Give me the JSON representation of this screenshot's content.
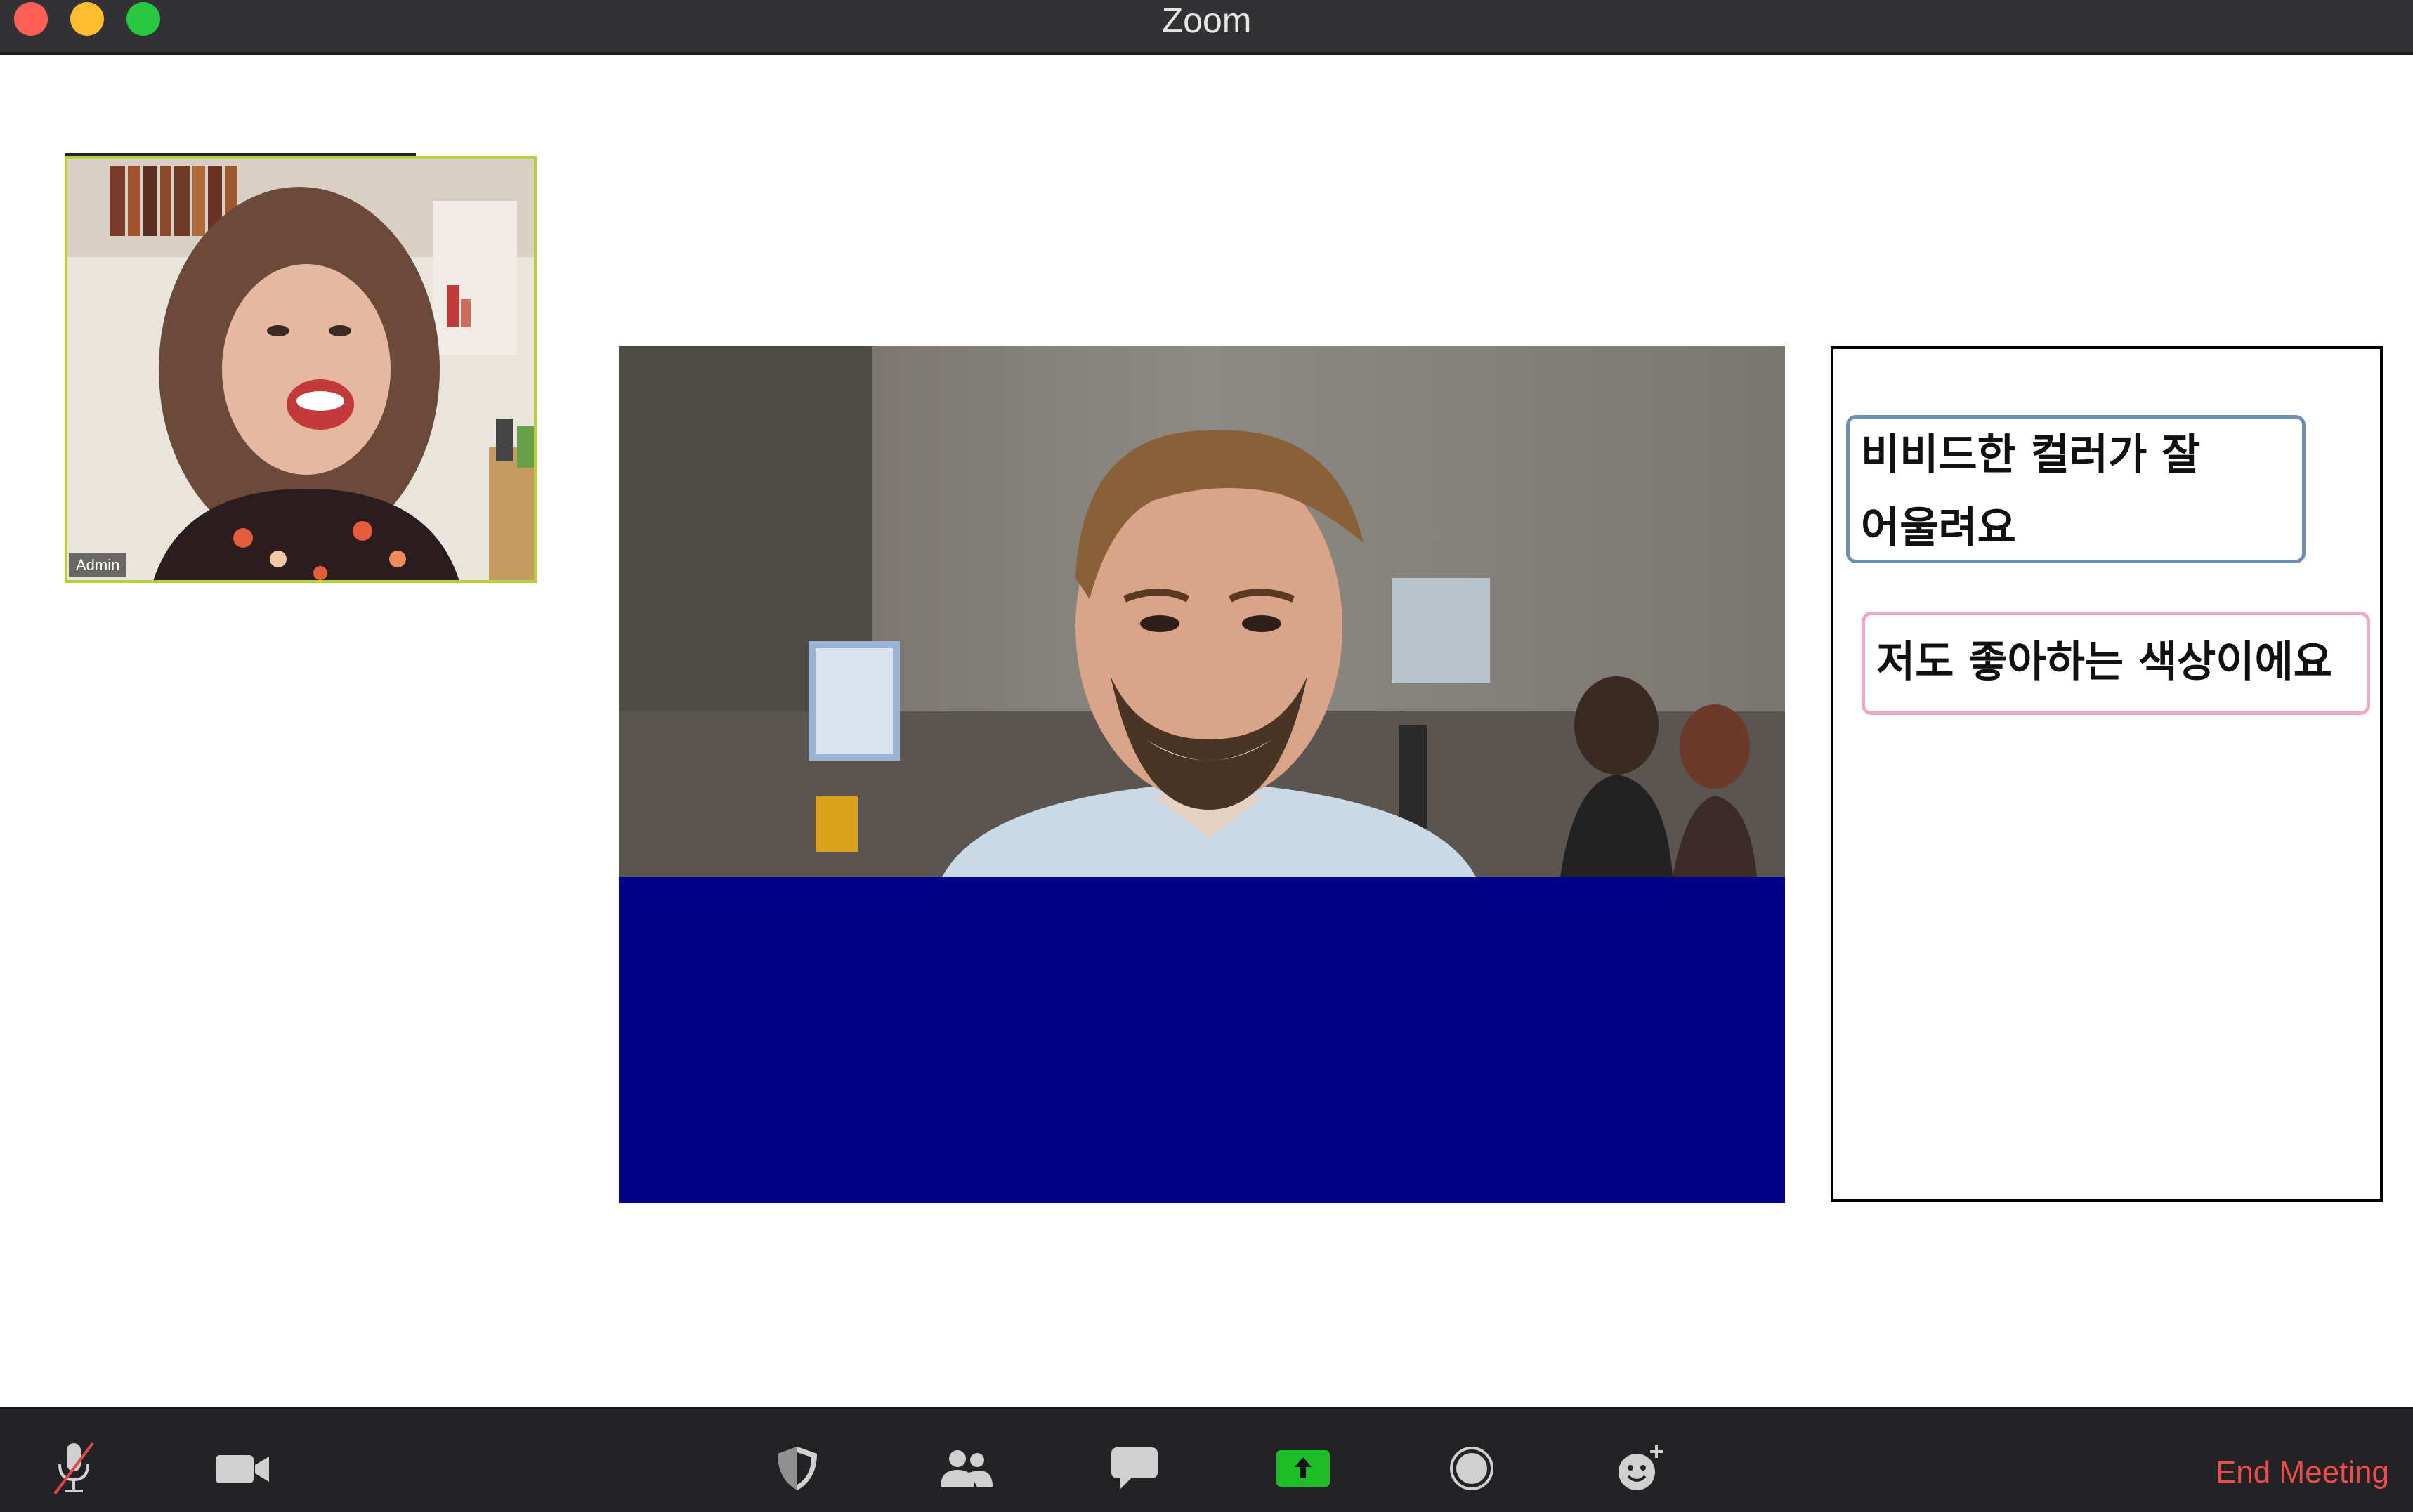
{
  "window": {
    "title": "Zoom"
  },
  "participant": {
    "name": "Admin"
  },
  "chat": {
    "messages": [
      {
        "text": "비비드한 컬러가 잘\n어울려요",
        "border_color": "#6e8fb3"
      },
      {
        "text": "저도 좋아하는 색상이에요",
        "border_color": "#f0a8c6"
      }
    ]
  },
  "overlay": {
    "color": "#000385"
  },
  "toolbar": {
    "buttons": [
      {
        "name": "mute",
        "icon": "microphone-muted-icon"
      },
      {
        "name": "video",
        "icon": "video-camera-icon"
      },
      {
        "name": "security",
        "icon": "shield-icon"
      },
      {
        "name": "participants",
        "icon": "people-icon"
      },
      {
        "name": "chat",
        "icon": "chat-bubble-icon"
      },
      {
        "name": "share-screen",
        "icon": "share-screen-icon"
      },
      {
        "name": "record",
        "icon": "record-icon"
      },
      {
        "name": "reactions",
        "icon": "add-reaction-icon"
      }
    ],
    "end_label": "End Meeting"
  }
}
